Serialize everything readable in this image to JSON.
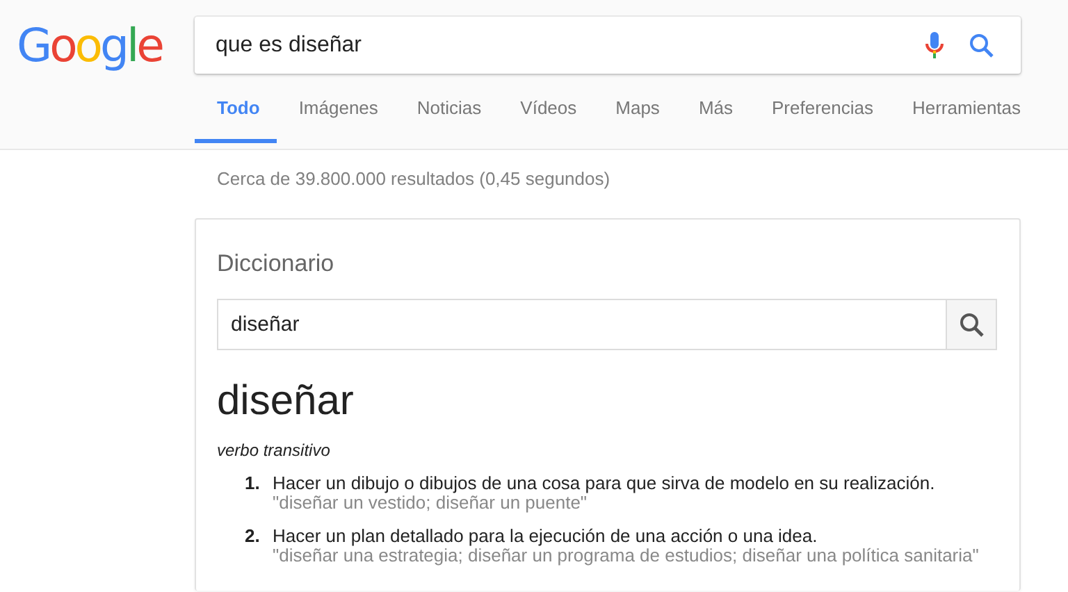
{
  "logo": "Google",
  "search": {
    "value": "que es diseñar"
  },
  "tabs": [
    {
      "label": "Todo",
      "selected": true
    },
    {
      "label": "Imágenes",
      "selected": false
    },
    {
      "label": "Noticias",
      "selected": false
    },
    {
      "label": "Vídeos",
      "selected": false
    },
    {
      "label": "Maps",
      "selected": false
    },
    {
      "label": "Más",
      "selected": false
    },
    {
      "label": "Preferencias",
      "selected": false
    },
    {
      "label": "Herramientas",
      "selected": false
    }
  ],
  "result_stats": "Cerca de 39.800.000 resultados (0,45 segundos)",
  "dictionary": {
    "title": "Diccionario",
    "search_value": "diseñar",
    "word": "diseñar",
    "part_of_speech": "verbo transitivo",
    "definitions": [
      {
        "number": "1.",
        "text": "Hacer un dibujo o dibujos de una cosa para que sirva de modelo en su realización.",
        "example": "\"diseñar un vestido; diseñar un puente\""
      },
      {
        "number": "2.",
        "text": "Hacer un plan detallado para la ejecución de una acción o una idea.",
        "example": "\"diseñar una estrategia; diseñar un programa de estudios; diseñar una política sanitaria\""
      }
    ]
  }
}
